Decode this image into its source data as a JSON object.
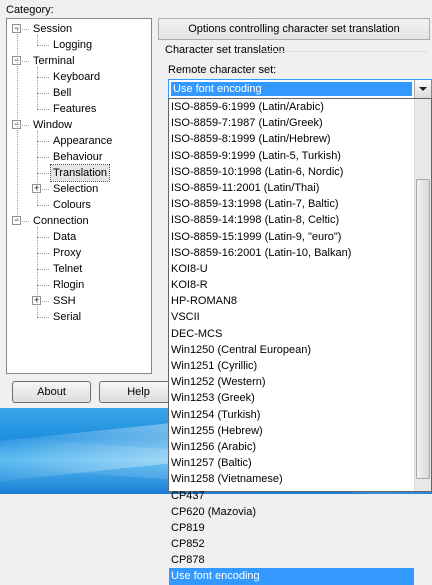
{
  "category_label": "Category:",
  "tree": [
    {
      "label": "Session",
      "level": 0,
      "expander": "−"
    },
    {
      "label": "Logging",
      "level": 1
    },
    {
      "label": "Terminal",
      "level": 0,
      "expander": "−"
    },
    {
      "label": "Keyboard",
      "level": 1
    },
    {
      "label": "Bell",
      "level": 1
    },
    {
      "label": "Features",
      "level": 1
    },
    {
      "label": "Window",
      "level": 0,
      "expander": "−"
    },
    {
      "label": "Appearance",
      "level": 1
    },
    {
      "label": "Behaviour",
      "level": 1
    },
    {
      "label": "Translation",
      "level": 1,
      "selected": true
    },
    {
      "label": "Selection",
      "level": 1,
      "expander": "+"
    },
    {
      "label": "Colours",
      "level": 1
    },
    {
      "label": "Connection",
      "level": 0,
      "expander": "−"
    },
    {
      "label": "Data",
      "level": 1
    },
    {
      "label": "Proxy",
      "level": 1
    },
    {
      "label": "Telnet",
      "level": 1
    },
    {
      "label": "Rlogin",
      "level": 1
    },
    {
      "label": "SSH",
      "level": 1,
      "expander": "+"
    },
    {
      "label": "Serial",
      "level": 1
    }
  ],
  "panel_title": "Options controlling character set translation",
  "group_title": "Character set translation",
  "remote_label": "Remote character set:",
  "combo_value": "Use font encoding",
  "dropdown_options": [
    "ISO-8859-6:1999 (Latin/Arabic)",
    "ISO-8859-7:1987 (Latin/Greek)",
    "ISO-8859-8:1999 (Latin/Hebrew)",
    "ISO-8859-9:1999 (Latin-5, Turkish)",
    "ISO-8859-10:1998 (Latin-6, Nordic)",
    "ISO-8859-11:2001 (Latin/Thai)",
    "ISO-8859-13:1998 (Latin-7, Baltic)",
    "ISO-8859-14:1998 (Latin-8, Celtic)",
    "ISO-8859-15:1999 (Latin-9, \"euro\")",
    "ISO-8859-16:2001 (Latin-10, Balkan)",
    "KOI8-U",
    "KOI8-R",
    "HP-ROMAN8",
    "VSCII",
    "DEC-MCS",
    "Win1250 (Central European)",
    "Win1251 (Cyrillic)",
    "Win1252 (Western)",
    "Win1253 (Greek)",
    "Win1254 (Turkish)",
    "Win1255 (Hebrew)",
    "Win1256 (Arabic)",
    "Win1257 (Baltic)",
    "Win1258 (Vietnamese)",
    "CP437",
    "CP620 (Mazovia)",
    "CP819",
    "CP852",
    "CP878",
    "Use font encoding"
  ],
  "selected_option": "Use font encoding",
  "buttons": {
    "about": "About",
    "help": "Help"
  },
  "colors": {
    "selection": "#3399ff",
    "dialog_bg": "#f0f0f0"
  }
}
